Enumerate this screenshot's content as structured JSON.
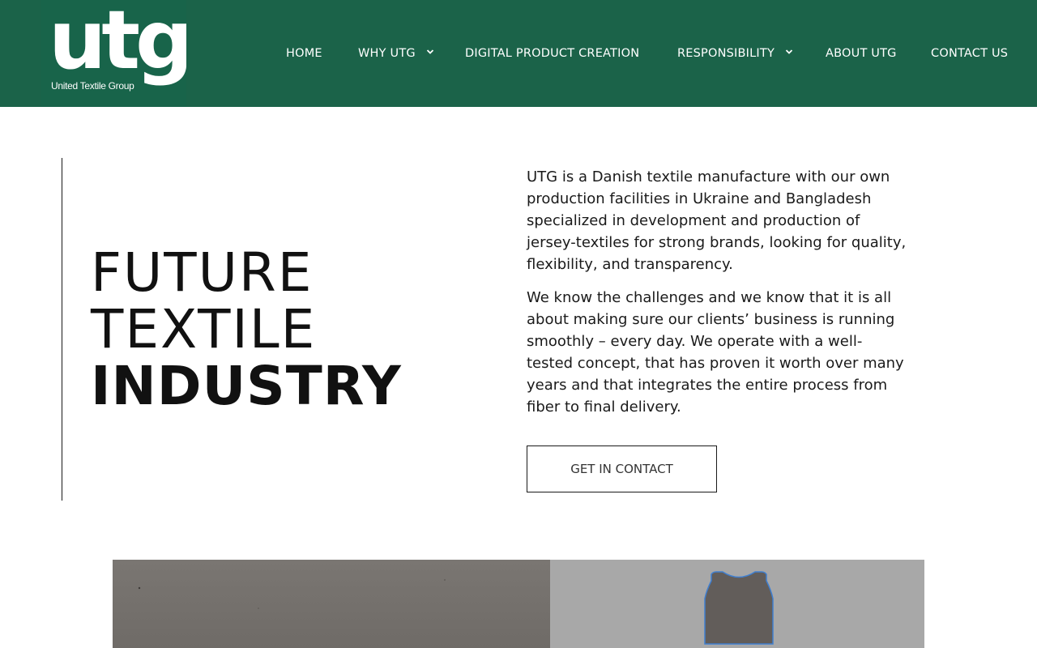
{
  "brand": {
    "logo_text": "utg",
    "logo_subtitle": "United Textile Group",
    "header_color": "#1b6349"
  },
  "nav": {
    "items": [
      {
        "label": "HOME",
        "has_dropdown": false
      },
      {
        "label": "WHY UTG",
        "has_dropdown": true
      },
      {
        "label": "DIGITAL PRODUCT CREATION",
        "has_dropdown": false
      },
      {
        "label": "RESPONSIBILITY",
        "has_dropdown": true
      },
      {
        "label": "ABOUT UTG",
        "has_dropdown": false
      },
      {
        "label": "CONTACT US",
        "has_dropdown": false
      }
    ]
  },
  "hero": {
    "headline_line1": "FUTURE",
    "headline_line2": "TEXTILE",
    "headline_line3": "INDUSTRY",
    "paragraph1": "UTG is a Danish textile manufacture with our own production facilities in Ukraine and Bangladesh specialized in development and production of jersey-textiles for strong brands, looking for quality, flexibility, and transparency.",
    "paragraph2": "We know the challenges and we know that it is all about making sure our clients’ business is running smoothly – every day. We operate with a well-tested concept, that has proven it worth over many years and that integrates the entire process from fiber to final delivery.",
    "cta_label": "GET IN CONTACT"
  },
  "images": {
    "left_photo": "concrete-surface",
    "right_photo": "garment-vest-pattern"
  }
}
